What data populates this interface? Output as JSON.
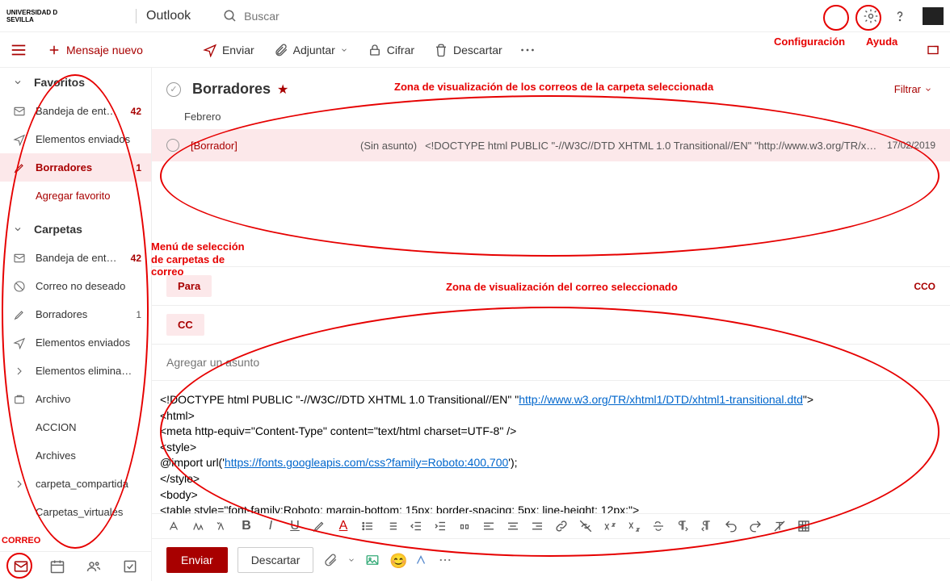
{
  "header": {
    "logo_text": "UNIVERSIDAD D SEVILLA",
    "app_name": "Outlook",
    "search_placeholder": "Buscar"
  },
  "annotations": {
    "config": "Configuración",
    "help": "Ayuda",
    "list_zone": "Zona de visualización de los correos de la carpeta seleccionada",
    "folder_menu": "Menú de selección de carpetas de correo",
    "msg_zone": "Zona de visualización del correo seleccionado",
    "mail": "CORREO"
  },
  "toolbar": {
    "new_message": "Mensaje nuevo",
    "send": "Enviar",
    "attach": "Adjuntar",
    "encrypt": "Cifrar",
    "discard": "Descartar"
  },
  "sidebar": {
    "favorites": "Favoritos",
    "fav_items": [
      {
        "label": "Bandeja de ent…",
        "count": "42"
      },
      {
        "label": "Elementos enviados",
        "count": ""
      },
      {
        "label": "Borradores",
        "count": "1",
        "active": true
      },
      {
        "label": "Agregar favorito",
        "count": "",
        "addfav": true
      }
    ],
    "folders": "Carpetas",
    "folder_items": [
      {
        "label": "Bandeja de ent…",
        "count": "42"
      },
      {
        "label": "Correo no deseado",
        "count": ""
      },
      {
        "label": "Borradores",
        "count": "1",
        "muted": true
      },
      {
        "label": "Elementos enviados",
        "count": ""
      },
      {
        "label": "Elementos elimina…",
        "count": ""
      },
      {
        "label": "Archivo",
        "count": ""
      },
      {
        "label": "ACCION",
        "count": ""
      },
      {
        "label": "Archives",
        "count": ""
      },
      {
        "label": "carpeta_compartida",
        "count": ""
      },
      {
        "label": "Carpetas_virtuales",
        "count": ""
      }
    ]
  },
  "list": {
    "title": "Borradores",
    "filter": "Filtrar",
    "month": "Febrero",
    "row": {
      "from": "[Borrador]",
      "nosubject": "(Sin asunto)",
      "preview": "<!DOCTYPE html PUBLIC \"-//W3C//DTD XHTML 1.0 Transitional//EN\" \"http://www.w3.org/TR/xhtml1…",
      "date": "17/02/2019"
    }
  },
  "compose": {
    "to": "Para",
    "cc": "CC",
    "cco": "CCO",
    "subject_placeholder": "Agregar un asunto",
    "body_l1": "<!DOCTYPE html PUBLIC \"-//W3C//DTD XHTML 1.0 Transitional//EN\" \"",
    "body_link1": "http://www.w3.org/TR/xhtml1/DTD/xhtml1-transitional.dtd",
    "body_l1b": "\">",
    "body_l2": "<html>",
    "body_l3": "  <meta http-equiv=\"Content-Type\" content=\"text/html charset=UTF-8\" />",
    "body_l4": "<style>",
    "body_l5": "@import url('",
    "body_link2": "https://fonts.googleapis.com/css?family=Roboto:400,700",
    "body_l5b": "');",
    "body_l6": "</style>",
    "body_l7": "  <body>",
    "body_l8": "   <table style=\"font-family:Roboto; margin-bottom: 15px; border-spacing: 5px; line-height: 12px;\">",
    "send": "Enviar",
    "discard": "Descartar"
  }
}
